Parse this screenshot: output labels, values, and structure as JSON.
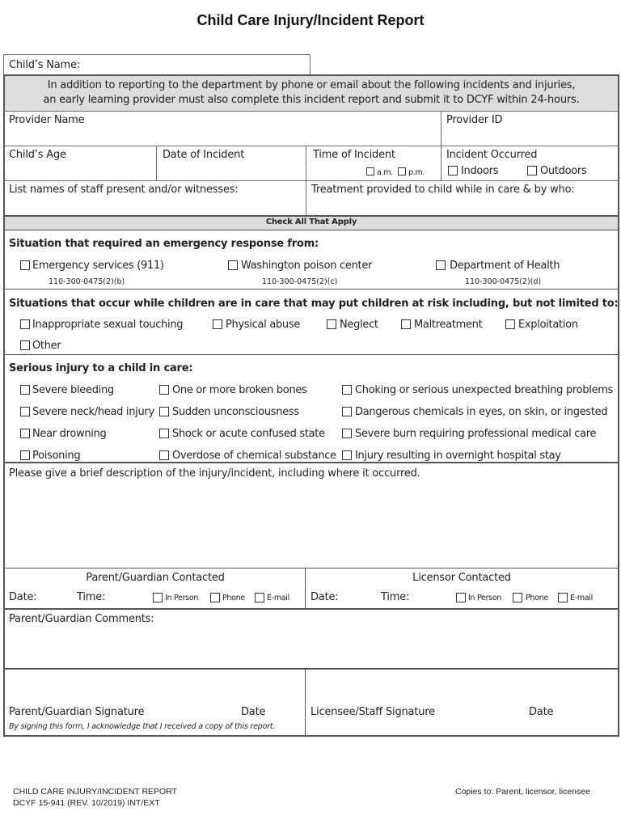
{
  "title": "Child Care Injury/Incident Report",
  "child_name": {
    "label": "Child’s Name:"
  },
  "notice": {
    "line1": "In addition to reporting to the department by phone or email about the following incidents and injuries,",
    "line2": "an early learning provider must also complete this incident report and submit it to DCYF within 24-hours."
  },
  "provider": {
    "name_label": "Provider Name",
    "id_label": "Provider ID"
  },
  "incident_row": {
    "age_label": "Child’s Age",
    "date_label": "Date of Incident",
    "time_label": "Time of Incident",
    "am_label": "a.m.",
    "pm_label": "p.m.",
    "occurred_label": "Incident Occurred",
    "indoors_label": "Indoors",
    "outdoors_label": "Outdoors"
  },
  "staff_row": {
    "staff_label": "List names of staff present and/or witnesses:",
    "treatment_label": "Treatment provided to child while in care & by who:"
  },
  "check_all": "Check All That Apply",
  "emergency": {
    "heading": "Situation that required an emergency response from:",
    "options": [
      {
        "label": "Emergency services (911)",
        "code": "110-300-0475(2)(b)",
        "checked": false
      },
      {
        "label": "Washington poison center",
        "code": "110-300-0475(2)(c)",
        "checked": false
      },
      {
        "label": "Department of Health",
        "code": "110-300-0475(2)(d)",
        "checked": false
      }
    ]
  },
  "risk": {
    "heading": "Situations that occur while children are in care that may put children at risk including, but not limited to:",
    "options": [
      {
        "label": "Inappropriate sexual touching",
        "checked": false
      },
      {
        "label": "Physical abuse",
        "checked": false
      },
      {
        "label": "Neglect",
        "checked": false
      },
      {
        "label": "Maltreatment",
        "checked": false
      },
      {
        "label": "Exploitation",
        "checked": false
      },
      {
        "label": "Other",
        "checked": false
      }
    ]
  },
  "injury": {
    "heading": "Serious injury to a child in care:",
    "options": [
      {
        "label": "Severe bleeding",
        "checked": false
      },
      {
        "label": "One or more broken bones",
        "checked": false
      },
      {
        "label": "Choking or serious unexpected breathing problems",
        "checked": false
      },
      {
        "label": "Severe neck/head injury",
        "checked": false
      },
      {
        "label": "Sudden unconsciousness",
        "checked": false
      },
      {
        "label": "Dangerous chemicals in eyes, on skin, or ingested",
        "checked": false
      },
      {
        "label": "Near drowning",
        "checked": false
      },
      {
        "label": "Shock or acute confused state",
        "checked": false
      },
      {
        "label": "Severe burn requiring professional medical care",
        "checked": false
      },
      {
        "label": "Poisoning",
        "checked": false
      },
      {
        "label": "Overdose of chemical substance",
        "checked": false
      },
      {
        "label": "Injury resulting in overnight hospital stay",
        "checked": false
      }
    ]
  },
  "description": {
    "label": "Please give a brief description of the injury/incident, including where it occurred."
  },
  "contacted": {
    "parent": {
      "heading": "Parent/Guardian Contacted",
      "date_label": "Date:",
      "time_label": "Time:",
      "methods": [
        "In Person",
        "Phone",
        "E-mail"
      ]
    },
    "licensor": {
      "heading": "Licensor Contacted",
      "date_label": "Date:",
      "time_label": "Time:",
      "methods": [
        "In Person",
        "Phone",
        "E-mail"
      ]
    }
  },
  "comments": {
    "label": "Parent/Guardian Comments:"
  },
  "signatures": {
    "parent_label": "Parent/Guardian Signature",
    "parent_date_label": "Date",
    "acknowledge": "By signing this form, I acknowledge that I received a copy of this report.",
    "staff_label": "Licensee/Staff Signature",
    "staff_date_label": "Date"
  },
  "footer": {
    "form_name": "CHILD CARE INJURY/INCIDENT REPORT",
    "form_code": "DCYF 15-941 (REV. 10/2019) INT/EXT",
    "copies": "Copies to:  Parent, licensor, licensee"
  },
  "colors": {
    "grey_fill": "#dcdcdc",
    "border": "#6e6e6e"
  }
}
